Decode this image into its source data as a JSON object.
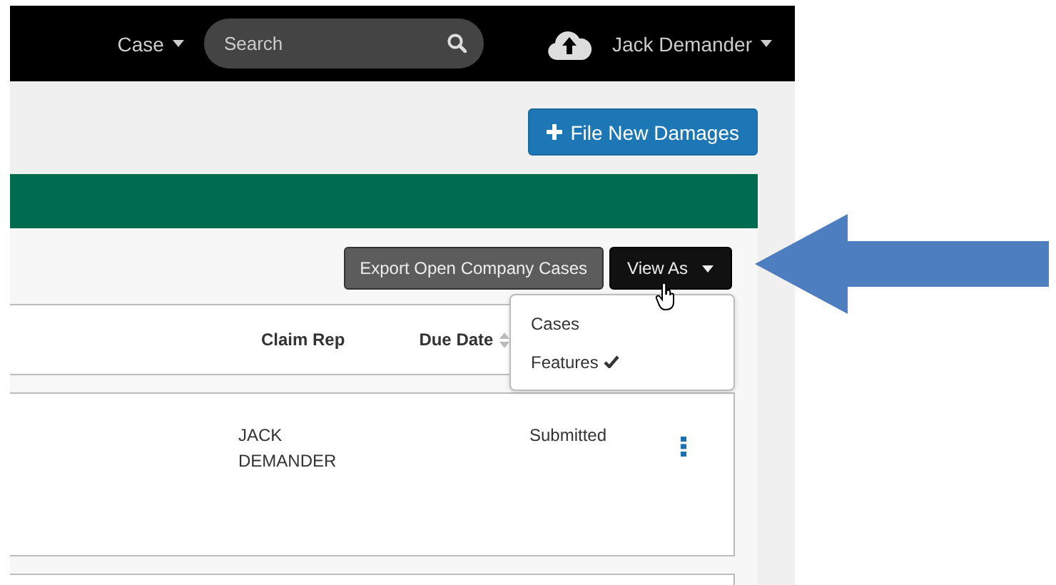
{
  "topbar": {
    "menu": "Case",
    "search": {
      "placeholder": "Search"
    },
    "user": "Jack Demander"
  },
  "file_button": "File New Damages",
  "toolbar": {
    "export_button": "Export Open Company Cases",
    "view_button": "View As"
  },
  "view_menu": [
    {
      "label": "Cases",
      "selected": false
    },
    {
      "label": "Features",
      "selected": true
    }
  ],
  "table": {
    "columns": [
      "Claim Rep",
      "Due Date"
    ],
    "rows": [
      {
        "claim_rep": "JACK DEMANDER",
        "status": "Submitted"
      }
    ]
  }
}
